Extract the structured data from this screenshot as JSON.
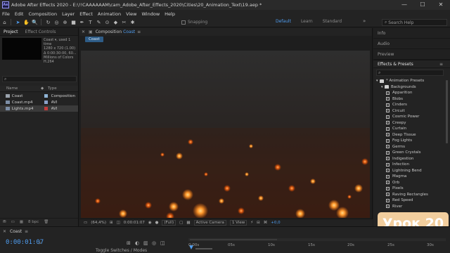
{
  "titlebar": {
    "app_icon": "Ae",
    "title": "Adobe After Effects 2020 - E:\\!!CAAAAAAM\\cam_Adobe_After_Effects_2020\\Cities\\20_Animation_Text\\19.aep *",
    "controls": [
      "—",
      "☐",
      "✕"
    ]
  },
  "menu": [
    "File",
    "Edit",
    "Composition",
    "Layer",
    "Effect",
    "Animation",
    "View",
    "Window",
    "Help"
  ],
  "toolbar": {
    "tools": [
      "home-icon",
      "selection-arrow-icon",
      "hand-icon",
      "zoom-icon",
      "rotate-icon",
      "camera-orbit-icon",
      "pan-behind-icon",
      "rectangle-icon",
      "pen-icon",
      "type-icon",
      "brush-icon",
      "clone-stamp-icon",
      "eraser-icon",
      "roto-brush-icon",
      "puppet-pin-icon"
    ],
    "tool_glyphs": [
      "⌂",
      "➤",
      "✋",
      "🔍",
      "↻",
      "◎",
      "⊕",
      "■",
      "✒",
      "T",
      "✎",
      "⊙",
      "◆",
      "✂",
      "✱"
    ],
    "snapping_label": "Snapping",
    "workspaces": [
      "Default",
      "Learn",
      "Standard"
    ],
    "workspace_more": "»",
    "search_help_placeholder": "Search Help"
  },
  "project": {
    "tabs": [
      "Project",
      "Effect Controls"
    ],
    "info_lines": [
      "Coast ▾, used 1 time",
      "1280 x 720 (1.00)",
      "Δ 0:00:30:00, 60...",
      "Millions of Colors",
      "H.264"
    ],
    "search_placeholder": "⌕",
    "columns": {
      "name": "Name",
      "type": "Type"
    },
    "items": [
      {
        "name": "Coast",
        "type": "Composition",
        "label_color": "#8fb4d6",
        "icon_color": "#9aa3ad"
      },
      {
        "name": "Coast.mp4",
        "type": "AVI",
        "label_color": "#8aa0c8",
        "icon_color": "#7c8ea6"
      },
      {
        "name": "Lights.mp4",
        "type": "AVI",
        "label_color": "#c23b3b",
        "icon_color": "#7c8ea6"
      }
    ],
    "bottom": [
      "⛃",
      "▭",
      "▦",
      "8 bpc",
      "🗑"
    ]
  },
  "composition": {
    "tab_label": "Composition",
    "tab_name": "Coast",
    "breadcrumb": "Coast",
    "footer": {
      "zoom": "(64,4%)",
      "time": "0:00:01:07",
      "resolution": "(Full)",
      "camera": "Active Camera",
      "views": "1 View",
      "exposure": "+0,0"
    }
  },
  "right_panels": {
    "mini_tabs": [
      "Info",
      "Audio",
      "Preview"
    ],
    "effects_title": "Effects & Presets",
    "effects_menu": "≡",
    "search_placeholder": "⌕",
    "tree": [
      {
        "label": "* Animation Presets",
        "level": 0,
        "kind": "folder-open"
      },
      {
        "label": "Backgrounds",
        "level": 1,
        "kind": "folder-open"
      },
      {
        "label": "Apparition",
        "level": 2,
        "kind": "preset"
      },
      {
        "label": "Blobs",
        "level": 2,
        "kind": "preset"
      },
      {
        "label": "Cinders",
        "level": 2,
        "kind": "preset"
      },
      {
        "label": "Circuit",
        "level": 2,
        "kind": "preset"
      },
      {
        "label": "Cosmic Power",
        "level": 2,
        "kind": "preset"
      },
      {
        "label": "Creepy",
        "level": 2,
        "kind": "preset"
      },
      {
        "label": "Curtain",
        "level": 2,
        "kind": "preset"
      },
      {
        "label": "Deep Tissue",
        "level": 2,
        "kind": "preset"
      },
      {
        "label": "Fog Lights",
        "level": 2,
        "kind": "preset"
      },
      {
        "label": "Germs",
        "level": 2,
        "kind": "preset"
      },
      {
        "label": "Green Crystals",
        "level": 2,
        "kind": "preset"
      },
      {
        "label": "Indigestion",
        "level": 2,
        "kind": "preset"
      },
      {
        "label": "Infection",
        "level": 2,
        "kind": "preset"
      },
      {
        "label": "Lightning Bend",
        "level": 2,
        "kind": "preset"
      },
      {
        "label": "Magma",
        "level": 2,
        "kind": "preset"
      },
      {
        "label": "Orb",
        "level": 2,
        "kind": "preset"
      },
      {
        "label": "Pixels",
        "level": 2,
        "kind": "preset"
      },
      {
        "label": "Raving Rectangles",
        "level": 2,
        "kind": "preset"
      },
      {
        "label": "Red Speed",
        "level": 2,
        "kind": "preset"
      },
      {
        "label": "River",
        "level": 2,
        "kind": "preset"
      }
    ]
  },
  "badge": {
    "text": "Урок 20",
    "color": "#f2ce9e"
  },
  "timeline": {
    "tab_name": "Coast",
    "current_time": "0:00:01:07",
    "toggle_label": "Toggle Switches / Modes",
    "ruler_ticks": [
      "0:00s",
      "05s",
      "10s",
      "15s",
      "20s",
      "25s",
      "30s"
    ]
  },
  "colors": {
    "accent": "#4f9df0",
    "panel": "#232323",
    "viewer_bg": "#1e1e1e"
  }
}
